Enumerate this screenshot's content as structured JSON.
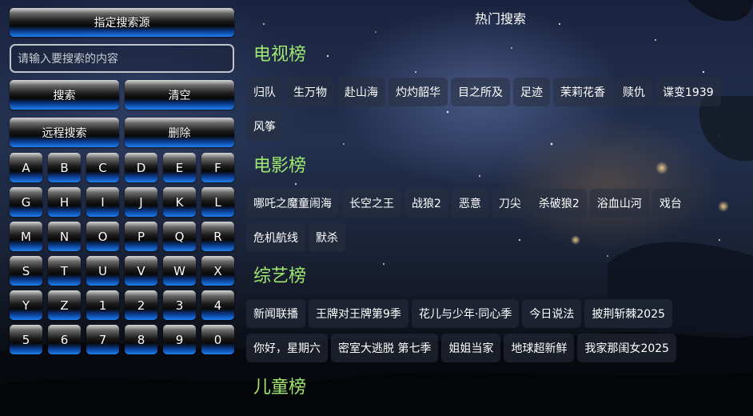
{
  "left_panel": {
    "source_button": "指定搜索源",
    "search_input": {
      "value": "",
      "placeholder": "请输入要搜索的内容"
    },
    "search_button": "搜索",
    "clear_button": "清空",
    "remote_search_button": "远程搜索",
    "delete_button": "删除",
    "keys": [
      "A",
      "B",
      "C",
      "D",
      "E",
      "F",
      "G",
      "H",
      "I",
      "J",
      "K",
      "L",
      "M",
      "N",
      "O",
      "P",
      "Q",
      "R",
      "S",
      "T",
      "U",
      "V",
      "W",
      "X",
      "Y",
      "Z",
      "1",
      "2",
      "3",
      "4",
      "5",
      "6",
      "7",
      "8",
      "9",
      "0"
    ]
  },
  "main": {
    "title": "热门搜索",
    "sections": [
      {
        "title": "电视榜",
        "rows": [
          [
            "归队",
            "生万物",
            "赴山海",
            "灼灼韶华",
            "目之所及",
            "足迹",
            "茉莉花香",
            "赎仇",
            "谍变1939"
          ],
          [
            "风筝"
          ]
        ]
      },
      {
        "title": "电影榜",
        "rows": [
          [
            "哪吒之魔童闹海",
            "长空之王",
            "战狼2",
            "恶意",
            "刀尖",
            "杀破狼2",
            "浴血山河",
            "戏台"
          ],
          [
            "危机航线",
            "默杀"
          ]
        ]
      },
      {
        "title": "综艺榜",
        "rows": [
          [
            "新闻联播",
            "王牌对王牌第9季",
            "花儿与少年·同心季",
            "今日说法",
            "披荆斩棘2025"
          ],
          [
            "你好，星期六",
            "密室大逃脱 第七季",
            "姐姐当家",
            "地球超新鲜",
            "我家那闺女2025"
          ]
        ]
      },
      {
        "title": "儿童榜",
        "rows": []
      }
    ]
  }
}
